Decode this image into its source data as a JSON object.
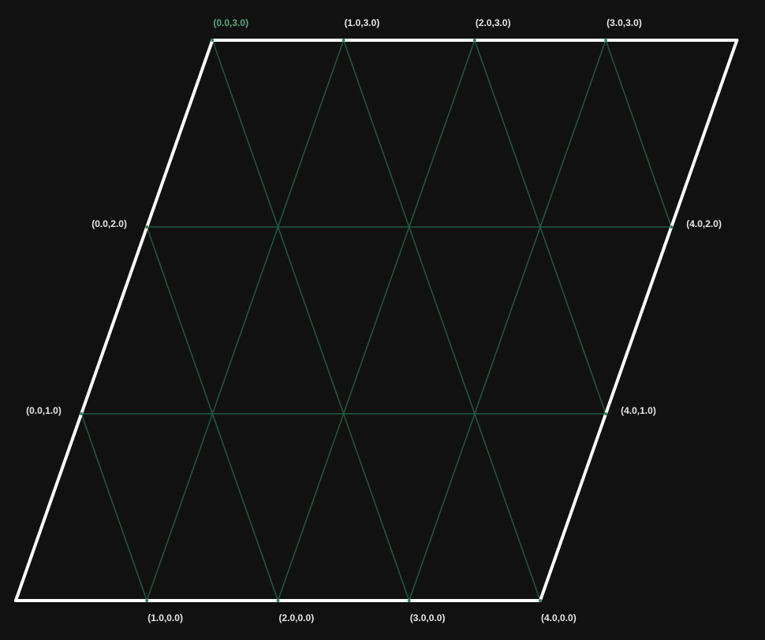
{
  "colors": {
    "background": "#111111",
    "border": "#ffffff",
    "grid_line": "#1f5a40",
    "vertex_dot": "#2f8a5a",
    "label_default": "#e6e6e6",
    "label_highlight": "#5aaa7e"
  },
  "lattice": {
    "columns": 4,
    "rows": 3,
    "highlighted_label": "(0.0,3.0)"
  },
  "points": [
    {
      "x": 1.0,
      "y": 0.0,
      "label": "(1.0,0.0)",
      "anchor": "below"
    },
    {
      "x": 2.0,
      "y": 0.0,
      "label": "(2.0,0.0)",
      "anchor": "below"
    },
    {
      "x": 3.0,
      "y": 0.0,
      "label": "(3.0,0.0)",
      "anchor": "below"
    },
    {
      "x": 4.0,
      "y": 0.0,
      "label": "(4.0,0.0)",
      "anchor": "below"
    },
    {
      "x": 0.0,
      "y": 1.0,
      "label": "(0.0,1.0)",
      "anchor": "left"
    },
    {
      "x": 4.0,
      "y": 1.0,
      "label": "(4.0,1.0)",
      "anchor": "right"
    },
    {
      "x": 0.0,
      "y": 2.0,
      "label": "(0.0,2.0)",
      "anchor": "left"
    },
    {
      "x": 4.0,
      "y": 2.0,
      "label": "(4.0,2.0)",
      "anchor": "right"
    },
    {
      "x": 0.0,
      "y": 3.0,
      "label": "(0.0,3.0)",
      "anchor": "above"
    },
    {
      "x": 1.0,
      "y": 3.0,
      "label": "(1.0,3.0)",
      "anchor": "above"
    },
    {
      "x": 2.0,
      "y": 3.0,
      "label": "(2.0,3.0)",
      "anchor": "above"
    },
    {
      "x": 3.0,
      "y": 3.0,
      "label": "(3.0,3.0)",
      "anchor": "above"
    }
  ]
}
